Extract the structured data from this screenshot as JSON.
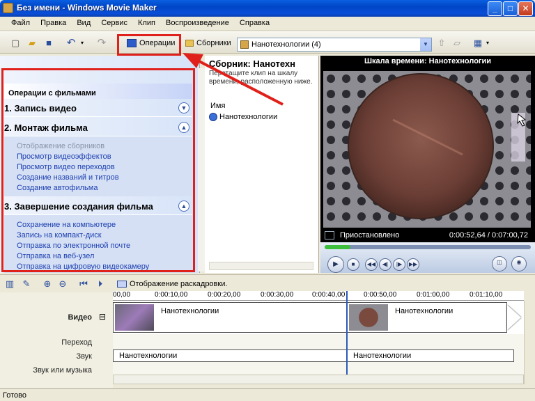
{
  "window": {
    "title": "Без имени - Windows Movie Maker",
    "controls": {
      "minimize": "_",
      "maximize": "□",
      "close": "✕"
    }
  },
  "menu": [
    "Файл",
    "Правка",
    "Вид",
    "Сервис",
    "Клип",
    "Воспроизведение",
    "Справка"
  ],
  "toolbar": {
    "operations_label": "Операции",
    "collections_label": "Сборники",
    "collection_selected": "Нанотехнологии (4)"
  },
  "task_pane": {
    "header": "Операции с фильмами",
    "sections": [
      {
        "title": "1. Запись видео",
        "expanded": false,
        "links": []
      },
      {
        "title": "2. Монтаж фильма",
        "expanded": true,
        "links": [
          {
            "label": "Отображение сборников",
            "disabled": true
          },
          {
            "label": "Просмотр видеоэффектов",
            "disabled": false
          },
          {
            "label": "Просмотр видео переходов",
            "disabled": false
          },
          {
            "label": "Создание названий и титров",
            "disabled": false
          },
          {
            "label": "Создание автофильма",
            "disabled": false
          }
        ]
      },
      {
        "title": "3. Завершение создания фильма",
        "expanded": true,
        "links": [
          {
            "label": "Сохранение на компьютере",
            "disabled": false
          },
          {
            "label": "Запись на компакт-диск",
            "disabled": false
          },
          {
            "label": "Отправка по электронной почте",
            "disabled": false
          },
          {
            "label": "Отправка на веб-узел",
            "disabled": false
          },
          {
            "label": "Отправка на цифровую видеокамеру",
            "disabled": false
          }
        ]
      }
    ]
  },
  "collection_pane": {
    "title": "Сборник: Нанотехн",
    "description": "Перетащите клип на шкалу времени, расположенную ниже.",
    "column_name": "Имя",
    "items": [
      "Нанотехнологии"
    ]
  },
  "monitor": {
    "title": "Шкала времени: Нанотехнологии",
    "status": "Приостановлено",
    "time": "0:00:52,64 / 0:07:00,72",
    "progress": 0.125
  },
  "timeline": {
    "storyboard_label": "Отображение раскадровки.",
    "ruler": [
      "00,00",
      "0:00:10,00",
      "0:00:20,00",
      "0:00:30,00",
      "0:00:40,00",
      "0:00:50,00",
      "0:01:00,00",
      "0:01:10,00"
    ],
    "tracks": {
      "video": "Видео",
      "transition": "Переход",
      "audio": "Звук",
      "music": "Звук или музыка"
    },
    "clips": [
      "Нанотехнологии",
      "Нанотехнологии"
    ],
    "audio_clips": [
      "Нанотехнологии",
      "Нанотехнологии"
    ],
    "collapse_glyph": "⊟"
  },
  "statusbar": {
    "text": "Готово"
  },
  "colors": {
    "highlight": "#E0201A",
    "xp_blue": "#0A4ED8",
    "link": "#1D3FB0"
  }
}
